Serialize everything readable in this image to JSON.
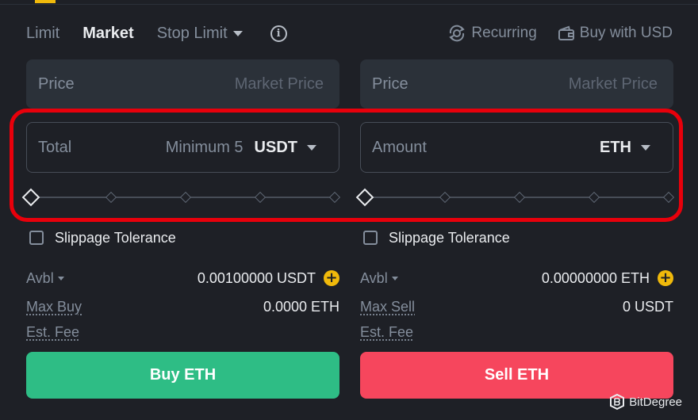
{
  "tabs": [
    {
      "label": "Limit",
      "active": false
    },
    {
      "label": "Market",
      "active": true
    },
    {
      "label": "Stop Limit",
      "active": false
    }
  ],
  "tools": {
    "recurring": "Recurring",
    "buy_with": "Buy with USD"
  },
  "buy": {
    "price_label": "Price",
    "price_value": "Market Price",
    "total_label": "Total",
    "total_hint": "Minimum 5",
    "total_unit": "USDT",
    "slippage": "Slippage Tolerance",
    "avbl_label": "Avbl",
    "avbl_value": "0.00100000 USDT",
    "max_label": "Max Buy",
    "max_value": "0.0000 ETH",
    "fee_label": "Est. Fee",
    "button": "Buy ETH"
  },
  "sell": {
    "price_label": "Price",
    "price_value": "Market Price",
    "amount_label": "Amount",
    "amount_unit": "ETH",
    "slippage": "Slippage Tolerance",
    "avbl_label": "Avbl",
    "avbl_value": "0.00000000 ETH",
    "max_label": "Max Sell",
    "max_value": "0 USDT",
    "fee_label": "Est. Fee",
    "button": "Sell ETH"
  },
  "slider_percent": {
    "buy": 0,
    "sell": 0
  },
  "watermark": "BitDegree",
  "colors": {
    "background": "#1e2026",
    "input": "#2b3139",
    "accent": "#f0b90b",
    "buy": "#2ebd85",
    "sell": "#f6465d",
    "highlight": "#e8000b"
  }
}
